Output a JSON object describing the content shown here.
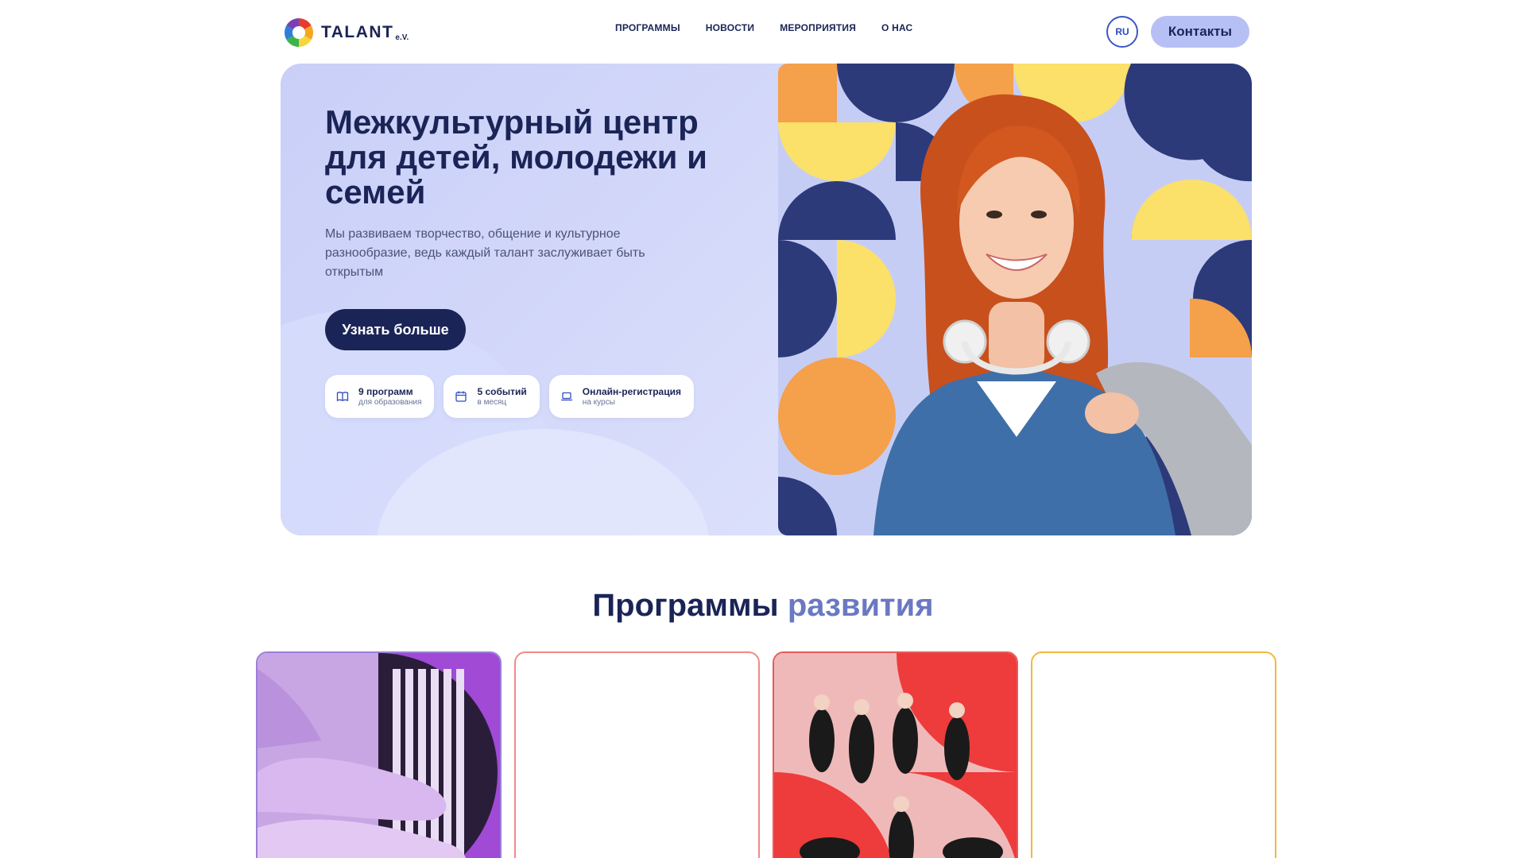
{
  "header": {
    "logo_text": "TALANT",
    "logo_suffix": "e.V.",
    "nav": [
      "ПРОГРАММЫ",
      "НОВОСТИ",
      "МЕРОПРИЯТИЯ",
      "О НАС"
    ],
    "lang": "RU",
    "contacts_label": "Контакты"
  },
  "hero": {
    "title": "Межкультурный центр для детей, молодежи и семей",
    "subtitle": "Мы развиваем творчество, общение и культурное разнообразие, ведь каждый талант заслуживает быть открытым",
    "cta_label": "Узнать больше",
    "badges": [
      {
        "title": "9 программ",
        "subtitle": "для образования",
        "icon": "book-icon"
      },
      {
        "title": "5 событий",
        "subtitle": "в месяц",
        "icon": "calendar-icon"
      },
      {
        "title": "Онлайн-регистрация",
        "subtitle": "на курсы",
        "icon": "laptop-icon"
      }
    ],
    "image": "smiling-girl-with-headphones-photo"
  },
  "programs": {
    "title_main": "Программы",
    "title_accent": "развития",
    "cards": [
      {
        "image": "piano-hands-photo",
        "border_color": "#9b7fd9"
      },
      {
        "image": "",
        "border_color": "#f08a8a"
      },
      {
        "image": "gymnastics-dancers-photo",
        "border_color": "#e85a5a"
      },
      {
        "image": "",
        "border_color": "#f4b73e"
      }
    ]
  },
  "colors": {
    "navy": "#1a2456",
    "accent_blue": "#6b78c2",
    "hero_bg": "#d0d6fa",
    "contacts_bg": "#b7c0f5"
  }
}
